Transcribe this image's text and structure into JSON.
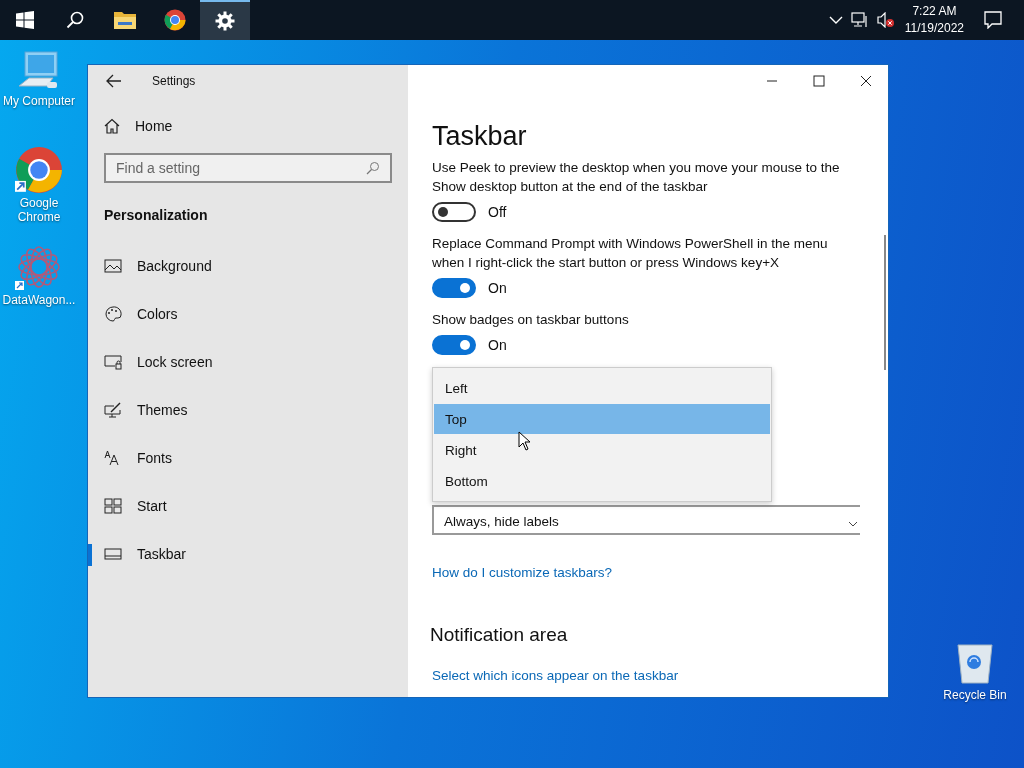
{
  "taskbar": {
    "buttons": [
      {
        "kind": "start",
        "selected": false
      },
      {
        "kind": "search",
        "selected": false
      },
      {
        "kind": "folder",
        "selected": false
      },
      {
        "kind": "chrome",
        "selected": false
      },
      {
        "kind": "gear",
        "selected": true
      }
    ],
    "time": "7:22 AM",
    "date": "11/19/2022"
  },
  "desktop_icons": [
    {
      "kind": "computer",
      "label": "My Computer"
    },
    {
      "kind": "chrome",
      "label": "Google Chrome"
    },
    {
      "kind": "app",
      "label": "DataWagon..."
    },
    {
      "kind": "recycle",
      "label": "Recycle Bin"
    }
  ],
  "window": {
    "title": "Settings",
    "sidebar": {
      "home": "Home",
      "search": {
        "placeholder": "Find a setting"
      },
      "section": "Personalization",
      "items": [
        {
          "kind": "background",
          "label": "Background",
          "selected": false
        },
        {
          "kind": "colors",
          "label": "Colors",
          "selected": false
        },
        {
          "kind": "lock",
          "label": "Lock screen",
          "selected": false
        },
        {
          "kind": "themes",
          "label": "Themes",
          "selected": false
        },
        {
          "kind": "fonts",
          "label": "Fonts",
          "selected": false
        },
        {
          "kind": "start",
          "label": "Start",
          "selected": false
        },
        {
          "kind": "taskbar",
          "label": "Taskbar",
          "selected": true
        }
      ]
    },
    "content": {
      "heading": "Taskbar",
      "settings": [
        {
          "label": "Use Peek to preview the desktop when you move your mouse to the Show desktop button at the end of the taskbar",
          "on": false,
          "state": "Off"
        },
        {
          "label": "Replace Command Prompt with Windows PowerShell in the menu when I right-click the start button or press Windows key+X",
          "on": true,
          "state": "On"
        },
        {
          "label": "Show badges on taskbar buttons",
          "on": true,
          "state": "On"
        }
      ],
      "dropdown_options": [
        {
          "label": "Left",
          "selected": false
        },
        {
          "label": "Top",
          "selected": true
        },
        {
          "label": "Right",
          "selected": false
        },
        {
          "label": "Bottom",
          "selected": false
        }
      ],
      "combobox": {
        "value": "Always, hide labels"
      },
      "link": "How do I customize taskbars?",
      "section": "Notification area",
      "section_link": "Select which icons appear on the taskbar"
    }
  }
}
